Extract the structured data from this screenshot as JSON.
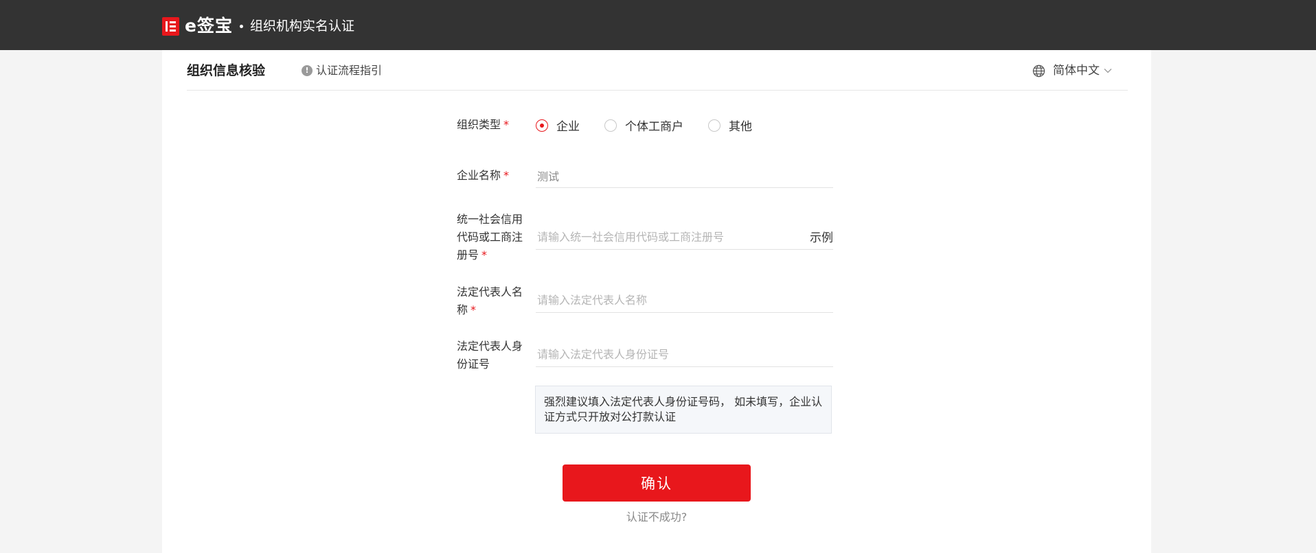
{
  "header": {
    "brand_name": "e签宝",
    "page_title": "组织机构实名认证"
  },
  "section": {
    "title": "组织信息核验",
    "guide_link": "认证流程指引",
    "language": "简体中文"
  },
  "form": {
    "org_type": {
      "label": "组织类型",
      "required_mark": "*",
      "options": [
        "企业",
        "个体工商户",
        "其他"
      ],
      "selected": "企业"
    },
    "company_name": {
      "label": "企业名称",
      "required_mark": "*",
      "value": "测试"
    },
    "credit_code": {
      "label": "统一社会信用代码或工商注册号",
      "required_mark": "*",
      "placeholder": "请输入统一社会信用代码或工商注册号",
      "example_label": "示例"
    },
    "legal_rep_name": {
      "label": "法定代表人名称",
      "required_mark": "*",
      "placeholder": "请输入法定代表人名称"
    },
    "legal_rep_id": {
      "label": "法定代表人身份证号",
      "placeholder": "请输入法定代表人身份证号"
    },
    "tip": "强烈建议填入法定代表人身份证号码， 如未填写，企业认证方式只开放对公打款认证",
    "confirm_label": "确认",
    "fail_link": "认证不成功?"
  },
  "colors": {
    "header_bg": "#333333",
    "accent": "#e8171c",
    "page_bg": "#f4f4f4"
  }
}
